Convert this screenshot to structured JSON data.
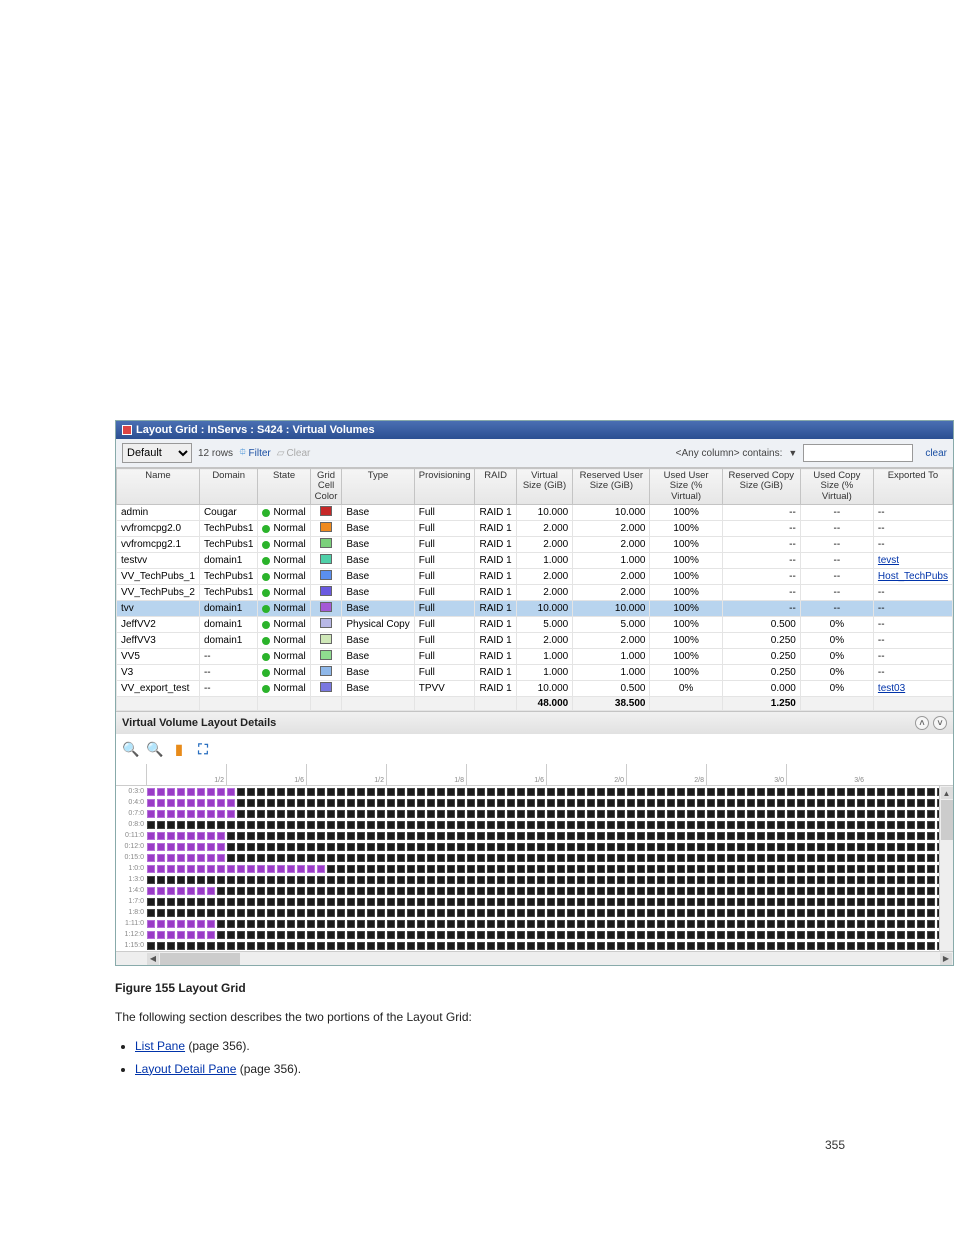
{
  "title": "Layout Grid : InServs : S424 : Virtual Volumes",
  "toolbar": {
    "view_select": "Default",
    "rows_label": "12 rows",
    "filter_label": "Filter",
    "clear_label": "Clear",
    "any_col_label": "<Any column> contains:",
    "search_value": "",
    "clear_right": "clear"
  },
  "columns": [
    "Name",
    "Domain",
    "State",
    "Grid Cell Color",
    "Type",
    "Provisioning",
    "RAID",
    "Virtual Size (GiB)",
    "Reserved User Size (GiB)",
    "Used User Size (% Virtual)",
    "Reserved Copy Size (GiB)",
    "Used Copy Size (% Virtual)",
    "Exported To"
  ],
  "rows": [
    {
      "name": "admin",
      "domain": "Cougar",
      "state": "Normal",
      "color": "#c62828",
      "type": "Base",
      "prov": "Full",
      "raid": "RAID 1",
      "vsize": "10.000",
      "ruser": "10.000",
      "uupct": "100%",
      "rcopy": "--",
      "ucpct": "--",
      "exp": "--"
    },
    {
      "name": "vvfromcpg2.0",
      "domain": "TechPubs1",
      "state": "Normal",
      "color": "#ef8a1e",
      "type": "Base",
      "prov": "Full",
      "raid": "RAID 1",
      "vsize": "2.000",
      "ruser": "2.000",
      "uupct": "100%",
      "rcopy": "--",
      "ucpct": "--",
      "exp": "--"
    },
    {
      "name": "vvfromcpg2.1",
      "domain": "TechPubs1",
      "state": "Normal",
      "color": "#7bd07b",
      "type": "Base",
      "prov": "Full",
      "raid": "RAID 1",
      "vsize": "2.000",
      "ruser": "2.000",
      "uupct": "100%",
      "rcopy": "--",
      "ucpct": "--",
      "exp": "--"
    },
    {
      "name": "testvv",
      "domain": "domain1",
      "state": "Normal",
      "color": "#4fd0a8",
      "type": "Base",
      "prov": "Full",
      "raid": "RAID 1",
      "vsize": "1.000",
      "ruser": "1.000",
      "uupct": "100%",
      "rcopy": "--",
      "ucpct": "--",
      "exp": "tevst",
      "explink": true
    },
    {
      "name": "VV_TechPubs_1",
      "domain": "TechPubs1",
      "state": "Normal",
      "color": "#5a8ff0",
      "type": "Base",
      "prov": "Full",
      "raid": "RAID 1",
      "vsize": "2.000",
      "ruser": "2.000",
      "uupct": "100%",
      "rcopy": "--",
      "ucpct": "--",
      "exp": "Host_TechPubs",
      "explink": true
    },
    {
      "name": "VV_TechPubs_2",
      "domain": "TechPubs1",
      "state": "Normal",
      "color": "#6a5ae0",
      "type": "Base",
      "prov": "Full",
      "raid": "RAID 1",
      "vsize": "2.000",
      "ruser": "2.000",
      "uupct": "100%",
      "rcopy": "--",
      "ucpct": "--",
      "exp": "--"
    },
    {
      "name": "tvv",
      "domain": "domain1",
      "state": "Normal",
      "color": "#a459d6",
      "type": "Base",
      "prov": "Full",
      "raid": "RAID 1",
      "vsize": "10.000",
      "ruser": "10.000",
      "uupct": "100%",
      "rcopy": "--",
      "ucpct": "--",
      "exp": "--",
      "selected": true
    },
    {
      "name": "JeffVV2",
      "domain": "domain1",
      "state": "Normal",
      "color": "#b8b8e6",
      "type": "Physical Copy",
      "prov": "Full",
      "raid": "RAID 1",
      "vsize": "5.000",
      "ruser": "5.000",
      "uupct": "100%",
      "rcopy": "0.500",
      "ucpct": "0%",
      "exp": "--"
    },
    {
      "name": "JeffVV3",
      "domain": "domain1",
      "state": "Normal",
      "color": "#cfe8b8",
      "type": "Base",
      "prov": "Full",
      "raid": "RAID 1",
      "vsize": "2.000",
      "ruser": "2.000",
      "uupct": "100%",
      "rcopy": "0.250",
      "ucpct": "0%",
      "exp": "--"
    },
    {
      "name": "VV5",
      "domain": "--",
      "state": "Normal",
      "color": "#8fdc8f",
      "type": "Base",
      "prov": "Full",
      "raid": "RAID 1",
      "vsize": "1.000",
      "ruser": "1.000",
      "uupct": "100%",
      "rcopy": "0.250",
      "ucpct": "0%",
      "exp": "--"
    },
    {
      "name": "V3",
      "domain": "--",
      "state": "Normal",
      "color": "#8fb8ea",
      "type": "Base",
      "prov": "Full",
      "raid": "RAID 1",
      "vsize": "1.000",
      "ruser": "1.000",
      "uupct": "100%",
      "rcopy": "0.250",
      "ucpct": "0%",
      "exp": "--"
    },
    {
      "name": "VV_export_test",
      "domain": "--",
      "state": "Normal",
      "color": "#7a78e0",
      "type": "Base",
      "prov": "TPVV",
      "raid": "RAID 1",
      "vsize": "10.000",
      "ruser": "0.500",
      "uupct": "0%",
      "rcopy": "0.000",
      "ucpct": "0%",
      "exp": "test03",
      "explink": true
    }
  ],
  "totals": {
    "vsize": "48.000",
    "ruser": "38.500",
    "rcopy": "1.250"
  },
  "details_header": "Virtual Volume Layout Details",
  "ruler_marks": [
    "1/2",
    "1/6",
    "1/2",
    "1/8",
    "1/6",
    "2/0",
    "2/8",
    "3/0",
    "3/6"
  ],
  "matrix_rows": [
    {
      "label": "0:3:0",
      "fill": 9
    },
    {
      "label": "0:4:0",
      "fill": 9
    },
    {
      "label": "0:7:0",
      "fill": 9
    },
    {
      "label": "0:8:0",
      "fill": 0
    },
    {
      "label": "0:11:0",
      "fill": 8
    },
    {
      "label": "0:12:0",
      "fill": 8
    },
    {
      "label": "0:15:0",
      "fill": 8
    },
    {
      "label": "1:0:0",
      "fill": 18
    },
    {
      "label": "1:3:0",
      "fill": 0
    },
    {
      "label": "1:4:0",
      "fill": 7
    },
    {
      "label": "1:7:0",
      "fill": 0
    },
    {
      "label": "1:8:0",
      "fill": 0
    },
    {
      "label": "1:11:0",
      "fill": 7
    },
    {
      "label": "1:12:0",
      "fill": 7
    },
    {
      "label": "1:15:0",
      "fill": 0
    }
  ],
  "figure_label": "Figure 155 Layout Grid",
  "body_para": "The following section describes the two portions of the Layout Grid:",
  "bullets": [
    {
      "text": "List Pane",
      "link": true,
      "tail": " (page 356)."
    },
    {
      "text": "Layout Detail Pane",
      "link": true,
      "tail": " (page 356)."
    }
  ],
  "page_num": "355"
}
